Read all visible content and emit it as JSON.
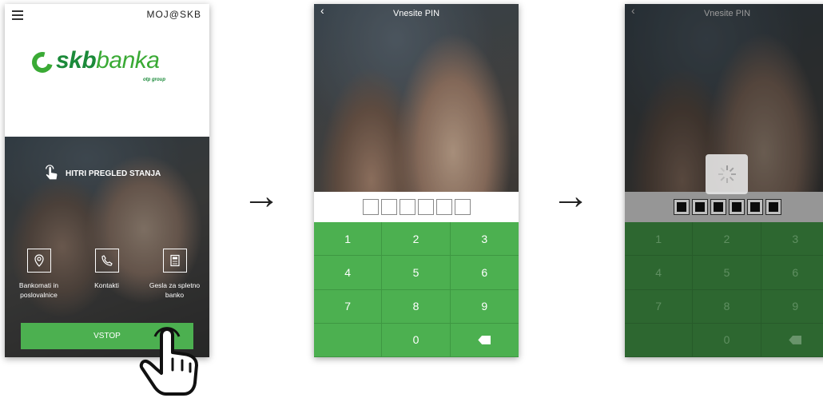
{
  "screen1": {
    "brand_header": "MOJ@SKB",
    "logo": {
      "name": "skb",
      "name2": "banka",
      "sub": "otp group"
    },
    "quick_view_label": "HITRI PREGLED STANJA",
    "tiles": [
      {
        "label": "Bankomati in poslovalnice",
        "icon": "location-pin-icon"
      },
      {
        "label": "Kontakti",
        "icon": "phone-icon"
      },
      {
        "label": "Gesla za spletno banko",
        "icon": "token-calculator-icon"
      }
    ],
    "enter_button": "VSTOP"
  },
  "screen2": {
    "title": "Vnesite PIN",
    "keys": [
      "1",
      "2",
      "3",
      "4",
      "5",
      "6",
      "7",
      "8",
      "9",
      "",
      "0",
      "⌫"
    ]
  },
  "screen3": {
    "title": "Vnesite PIN",
    "keys": [
      "1",
      "2",
      "3",
      "4",
      "5",
      "6",
      "7",
      "8",
      "9",
      "",
      "0",
      "⌫"
    ]
  },
  "arrows": [
    "→",
    "→"
  ],
  "colors": {
    "accent_green": "#4cb050",
    "logo_green": "#1b8a3a"
  }
}
